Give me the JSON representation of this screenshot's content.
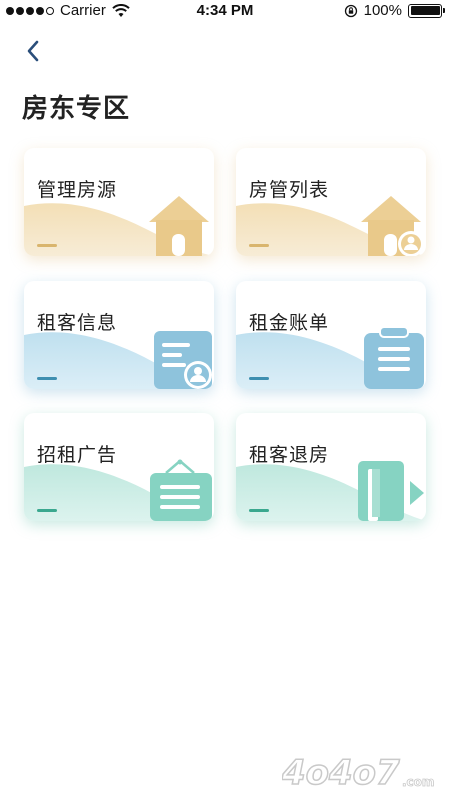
{
  "status_bar": {
    "carrier": "Carrier",
    "time": "4:34 PM",
    "battery": "100%",
    "battery_level": 1.0
  },
  "header": {
    "title": "房东专区",
    "back_icon": "chevron-left-icon"
  },
  "cards": [
    {
      "label": "管理房源",
      "theme": "gold",
      "icon": "house-icon"
    },
    {
      "label": "房管列表",
      "theme": "gold",
      "icon": "house-person-icon"
    },
    {
      "label": "租客信息",
      "theme": "blue",
      "icon": "contact-card-icon"
    },
    {
      "label": "租金账单",
      "theme": "blue",
      "icon": "clipboard-icon"
    },
    {
      "label": "招租广告",
      "theme": "green",
      "icon": "sign-board-icon"
    },
    {
      "label": "租客退房",
      "theme": "green",
      "icon": "door-exit-icon"
    }
  ],
  "colors": {
    "gold": "#e8c98e",
    "blue": "#8ec3dc",
    "green": "#86d3c2",
    "back_arrow": "#2a4e7a"
  },
  "watermark": {
    "text": "4o4o7",
    "suffix": ".com"
  }
}
